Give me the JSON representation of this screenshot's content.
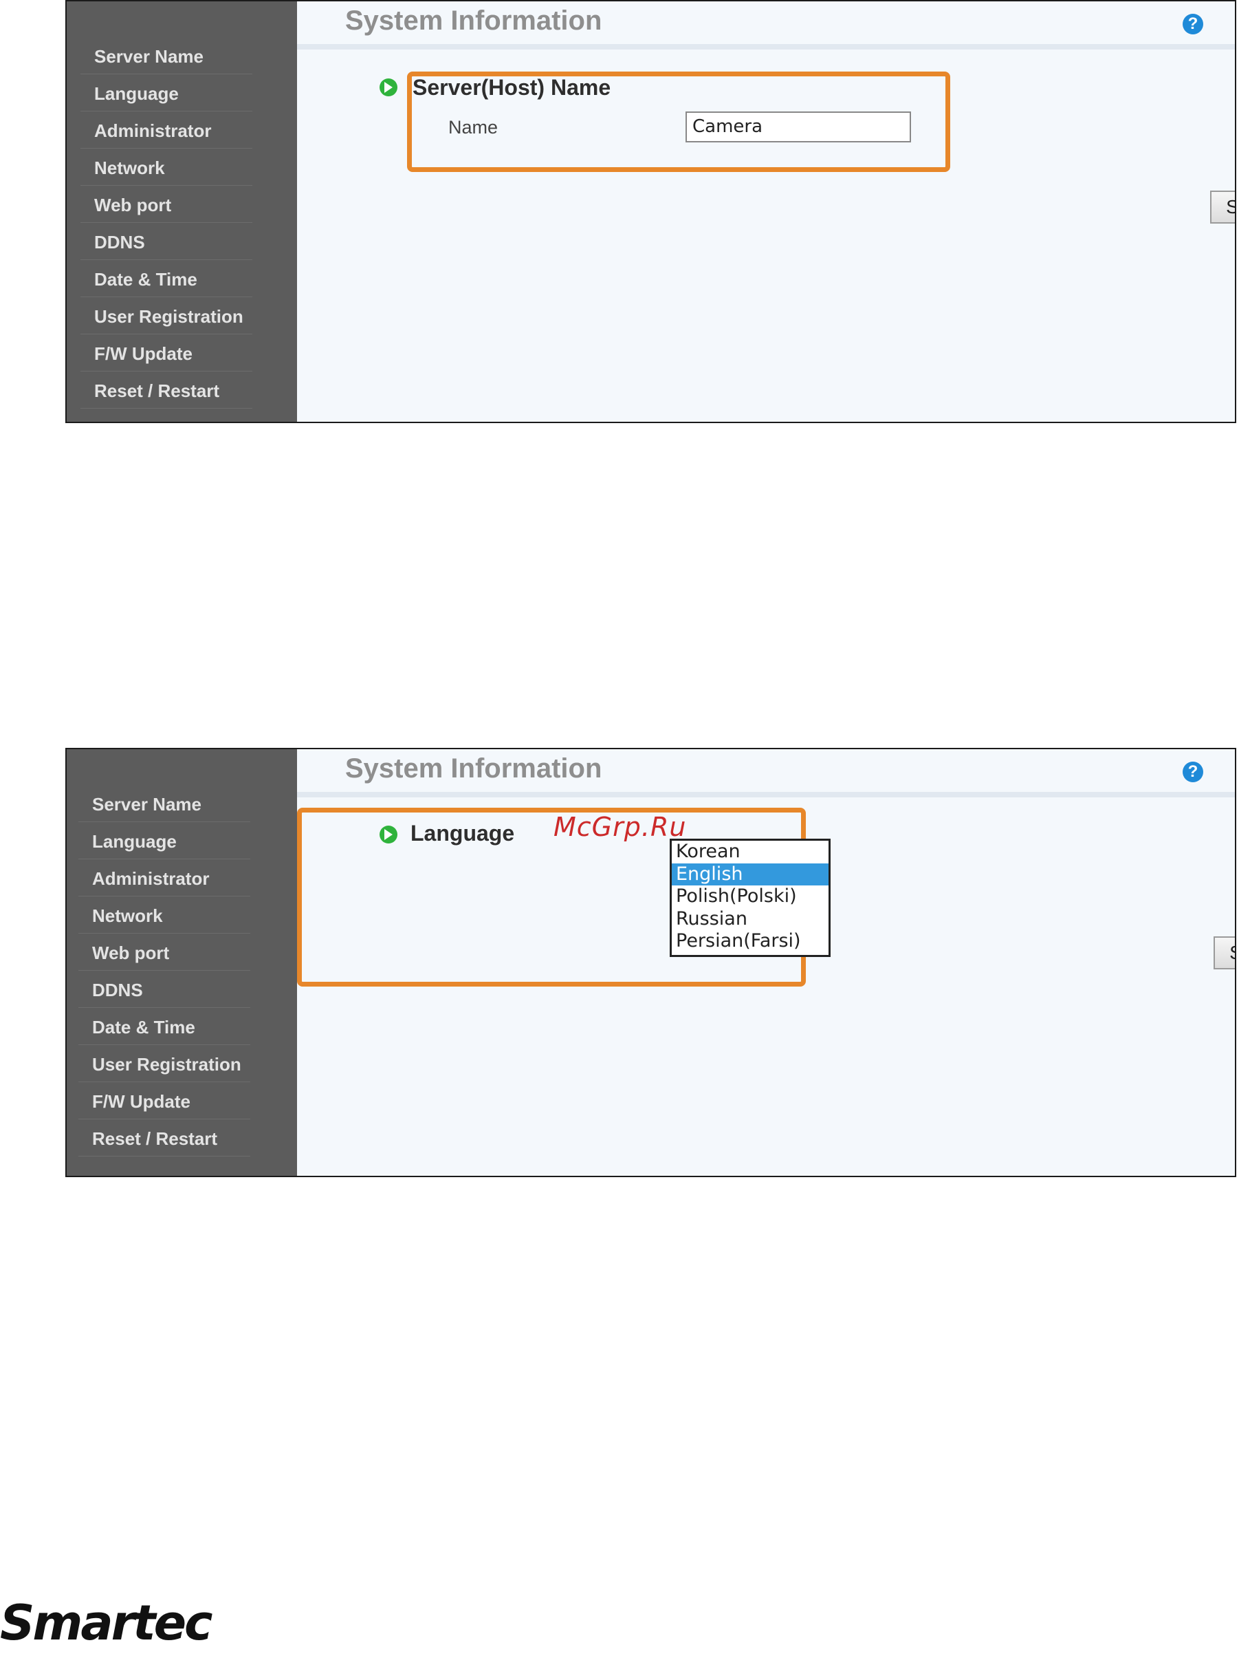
{
  "panel1": {
    "title": "System Information",
    "help_icon": "?",
    "sidebar": {
      "items": [
        {
          "label": "Server Name"
        },
        {
          "label": "Language"
        },
        {
          "label": "Administrator"
        },
        {
          "label": "Network"
        },
        {
          "label": "Web port"
        },
        {
          "label": "DDNS"
        },
        {
          "label": "Date & Time"
        },
        {
          "label": "User Registration"
        },
        {
          "label": "F/W Update"
        },
        {
          "label": "Reset / Restart"
        }
      ]
    },
    "section_title": "Server(Host) Name",
    "name_label": "Name",
    "name_value": "Camera",
    "save_label": "Save"
  },
  "panel2": {
    "title": "System Information",
    "help_icon": "?",
    "sidebar": {
      "items": [
        {
          "label": "Server Name"
        },
        {
          "label": "Language"
        },
        {
          "label": "Administrator"
        },
        {
          "label": "Network"
        },
        {
          "label": "Web port"
        },
        {
          "label": "DDNS"
        },
        {
          "label": "Date & Time"
        },
        {
          "label": "User Registration"
        },
        {
          "label": "F/W Update"
        },
        {
          "label": "Reset / Restart"
        }
      ]
    },
    "section_title": "Language",
    "language_options": [
      "Korean",
      "English",
      "Polish(Polski)",
      "Russian",
      "Persian(Farsi)"
    ],
    "selected_language": "English",
    "save_label": "Save"
  },
  "watermark": "McGrp.Ru",
  "logo": "Smartec",
  "colors": {
    "sidebar": "#5c5c5c",
    "highlight_border": "#e7872a",
    "selected_option": "#3399dd",
    "play_icon": "#2fb33c",
    "help_icon": "#1f8ad8"
  }
}
